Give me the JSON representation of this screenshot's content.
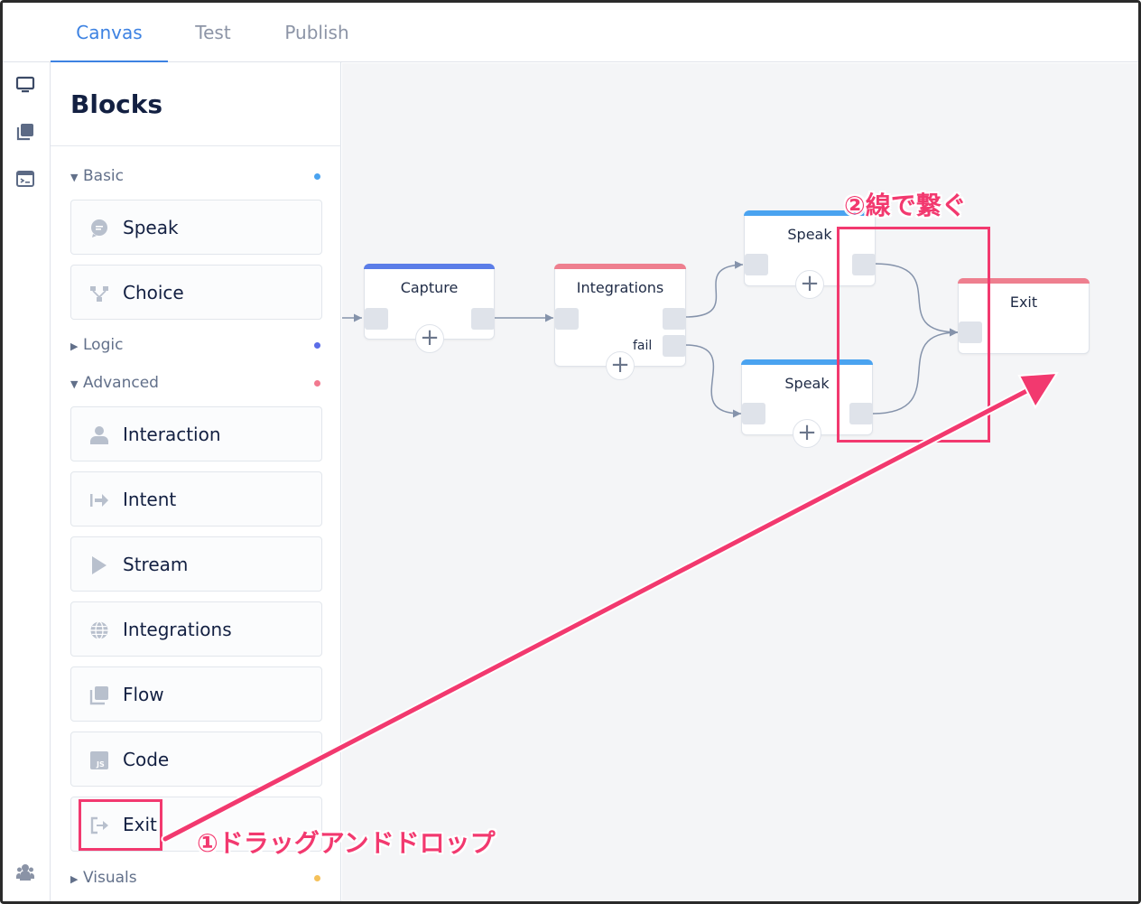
{
  "tabs": [
    {
      "label": "Canvas",
      "active": true
    },
    {
      "label": "Test",
      "active": false
    },
    {
      "label": "Publish",
      "active": false
    }
  ],
  "rail": {
    "icons": [
      "monitor-icon",
      "layers-icon",
      "terminal-icon",
      "team-icon"
    ]
  },
  "panel": {
    "title": "Blocks",
    "sections": [
      {
        "label": "Basic",
        "expanded": true,
        "dot_color": "#4aa3f0",
        "items": [
          {
            "label": "Speak",
            "icon": "speech-bubble-icon"
          },
          {
            "label": "Choice",
            "icon": "branch-icon"
          }
        ]
      },
      {
        "label": "Logic",
        "expanded": false,
        "dot_color": "#5b6de8",
        "items": []
      },
      {
        "label": "Advanced",
        "expanded": true,
        "dot_color": "#f2798f",
        "items": [
          {
            "label": "Interaction",
            "icon": "user-icon"
          },
          {
            "label": "Intent",
            "icon": "intent-arrow-icon"
          },
          {
            "label": "Stream",
            "icon": "play-icon"
          },
          {
            "label": "Integrations",
            "icon": "globe-icon"
          },
          {
            "label": "Flow",
            "icon": "stack-icon"
          },
          {
            "label": "Code",
            "icon": "js-file-icon"
          },
          {
            "label": "Exit",
            "icon": "exit-icon"
          }
        ]
      },
      {
        "label": "Visuals",
        "expanded": false,
        "dot_color": "#f5c15a",
        "items": []
      }
    ]
  },
  "canvas": {
    "nodes": [
      {
        "title": "Capture",
        "color": "#5b7de8"
      },
      {
        "title": "Integrations",
        "color": "#ee7f8f",
        "fail_label": "fail"
      },
      {
        "title": "Speak",
        "color": "#4aa3f0"
      },
      {
        "title": "Speak",
        "color": "#4aa3f0"
      },
      {
        "title": "Exit",
        "color": "#ee7f8f"
      }
    ],
    "add_symbol": "+"
  },
  "annotations": {
    "connect": "②線で繋ぐ",
    "drag": "①ドラッグアンドドロップ",
    "color": "#f2396f"
  }
}
